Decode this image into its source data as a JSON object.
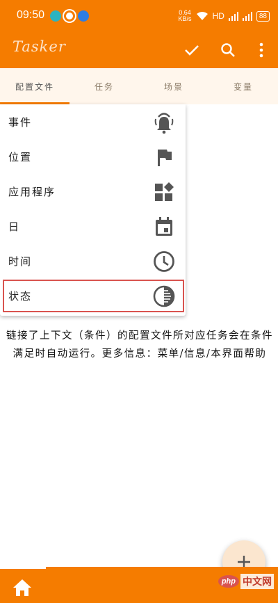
{
  "status_bar": {
    "time": "09:50",
    "network_speed_value": "0.64",
    "network_speed_unit": "KB/s",
    "network_type": "HD",
    "battery": "88"
  },
  "app_bar": {
    "title": "Tasker",
    "icons": [
      "check-icon",
      "search-icon",
      "more-vert-icon"
    ]
  },
  "tabs": [
    {
      "label": "配置文件",
      "active": true
    },
    {
      "label": "任务",
      "active": false
    },
    {
      "label": "场景",
      "active": false
    },
    {
      "label": "变量",
      "active": false
    }
  ],
  "menu": {
    "items": [
      {
        "label": "事件",
        "icon": "bell-icon"
      },
      {
        "label": "位置",
        "icon": "flag-icon"
      },
      {
        "label": "应用程序",
        "icon": "widgets-icon"
      },
      {
        "label": "日",
        "icon": "calendar-icon"
      },
      {
        "label": "时间",
        "icon": "clock-icon"
      },
      {
        "label": "状态",
        "icon": "contrast-icon",
        "highlighted": true
      }
    ]
  },
  "info": {
    "text": "链接了上下文（条件）的配置文件所对应任务会在条件满足时自动运行。更多信息：菜单/信息/本界面帮助"
  },
  "fab": {
    "label": "+"
  },
  "watermark": {
    "php": "php",
    "site": "中文网"
  },
  "colors": {
    "primary": "#f57c00",
    "tab_bg": "#fff6ec",
    "highlight": "#d9534f",
    "icon": "#555555"
  }
}
